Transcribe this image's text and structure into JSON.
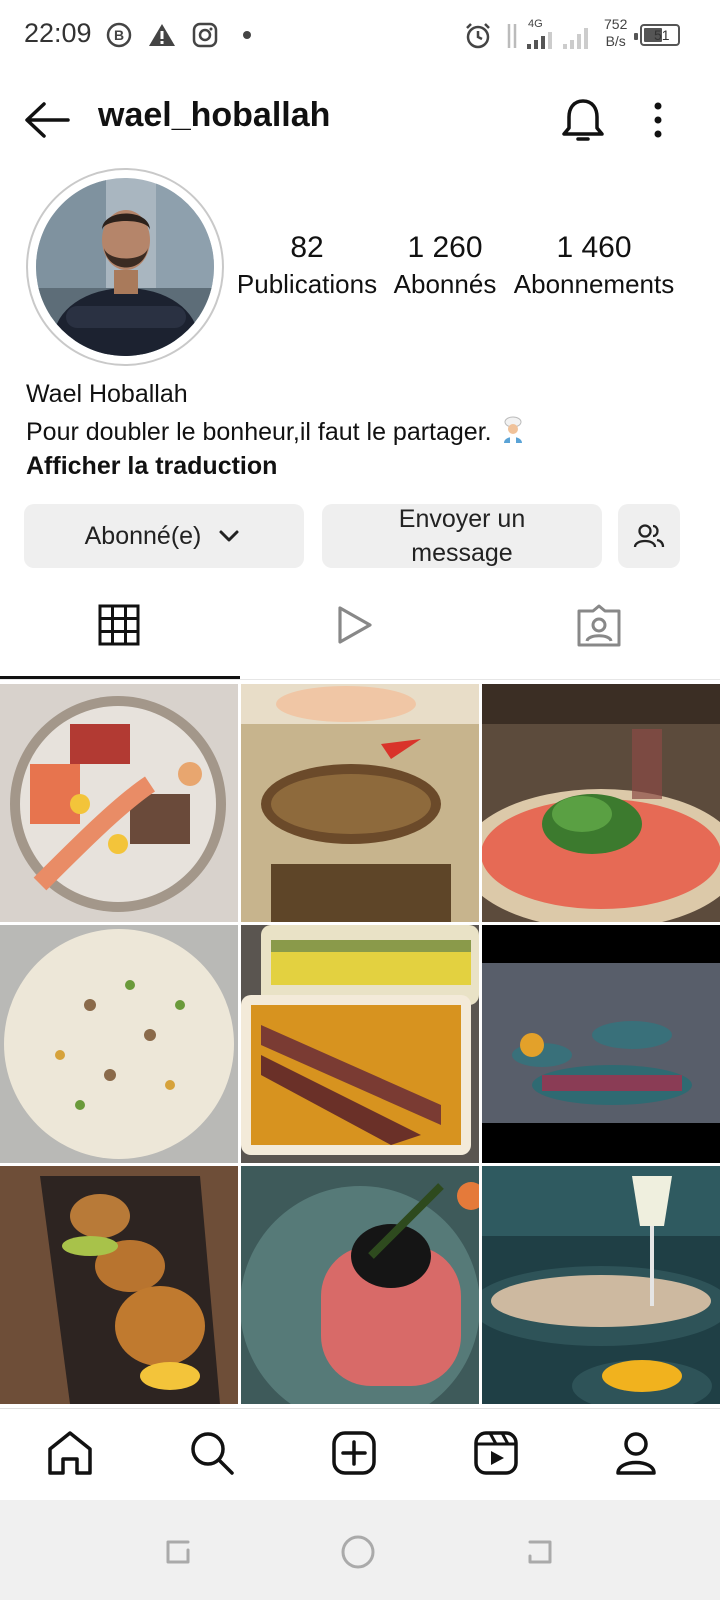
{
  "status_bar": {
    "time": "22:09",
    "network_label": "4G",
    "speed_value": "752",
    "speed_unit": "B/s",
    "battery": "51",
    "icons": [
      "b-circle-icon",
      "warning-icon",
      "instagram-icon",
      "dot-icon",
      "alarm-icon",
      "data-arrows-icon",
      "signal-icon",
      "signal-icon-2",
      "battery-icon"
    ]
  },
  "header": {
    "username": "wael_hoballah",
    "icons": [
      "back-arrow-icon",
      "bell-icon",
      "more-vertical-icon"
    ]
  },
  "profile": {
    "stats": [
      {
        "value": "82",
        "label": "Publications"
      },
      {
        "value": "1 260",
        "label": "Abonnés"
      },
      {
        "value": "1 460",
        "label": "Abonnements"
      }
    ],
    "name": "Wael Hoballah",
    "bio": "Pour doubler le bonheur,il faut le partager.",
    "bio_emoji": "🧑‍🍳",
    "translate_label": "Afficher la traduction"
  },
  "buttons": {
    "following_label": "Abonné(e)",
    "message_line1": "Envoyer un",
    "message_line2": "message",
    "suggest_icon": "add-people-icon"
  },
  "tabs": [
    {
      "name": "grid",
      "icon": "grid-icon",
      "active": true
    },
    {
      "name": "reels",
      "icon": "play-icon",
      "active": false
    },
    {
      "name": "tagged",
      "icon": "tagged-icon",
      "active": false
    }
  ],
  "posts": [
    {
      "desc": "seafood platter"
    },
    {
      "desc": "lobster tails"
    },
    {
      "desc": "tuna carpaccio with arugula"
    },
    {
      "desc": "fish carpaccio"
    },
    {
      "desc": "seared tuna slices"
    },
    {
      "desc": "restaurant table dishes"
    },
    {
      "desc": "croquettes"
    },
    {
      "desc": "tuna tartare with caviar"
    },
    {
      "desc": "wine and ceviche"
    }
  ],
  "bottom_nav": [
    "home-icon",
    "search-icon",
    "add-post-icon",
    "reels-icon",
    "profile-icon"
  ],
  "colors": {
    "text": "#111111",
    "button_bg": "#efefef",
    "border": "#e0e0e0"
  }
}
